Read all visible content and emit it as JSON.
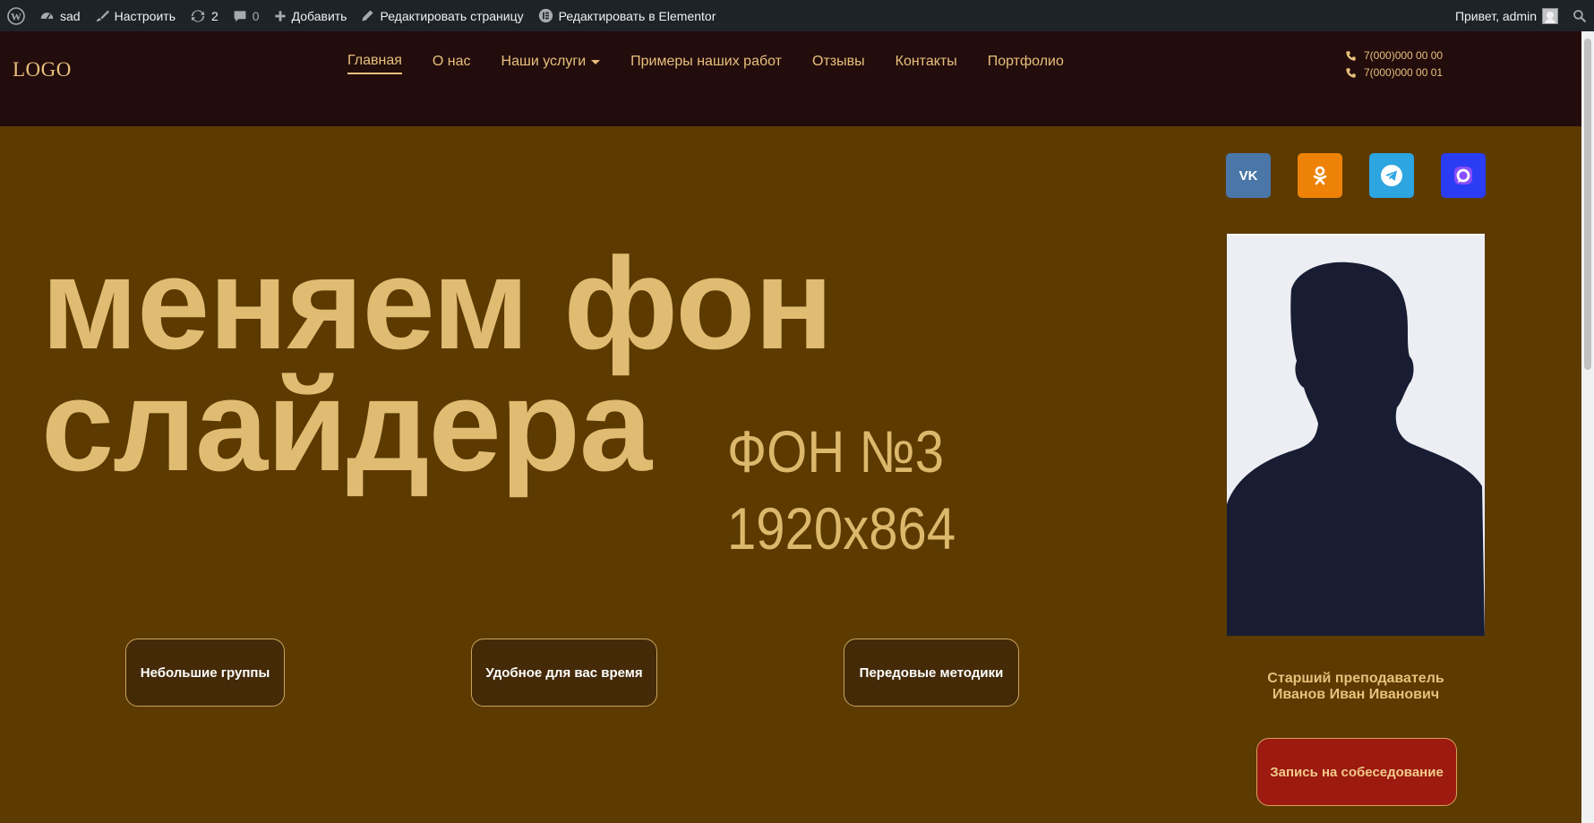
{
  "adminbar": {
    "site_name": "sad",
    "customize": "Настроить",
    "updates_count": "2",
    "comments_count": "0",
    "add_new": "Добавить",
    "edit_page": "Редактировать страницу",
    "edit_elementor": "Редактировать в Elementor",
    "greeting": "Привет, admin"
  },
  "header": {
    "logo": "LOGO",
    "nav": [
      "Главная",
      "О нас",
      "Наши услуги",
      "Примеры наших работ",
      "Отзывы",
      "Контакты",
      "Портфолио"
    ],
    "phones": [
      "7(000)000 00 00",
      "7(000)000 00 01"
    ]
  },
  "hero": {
    "title_line1": "меняем фон",
    "title_line2": "слайдера",
    "bg_label_line1": "ФОН №3",
    "bg_label_line2": "1920x864",
    "features": [
      "Небольшие группы",
      "Удобное для вас время",
      "Передовые методики"
    ],
    "teacher_role": "Старший преподаватель",
    "teacher_name": "Иванов Иван Иванович",
    "cta_label": "Запись на собеседование"
  },
  "colors": {
    "accent": "#e7c07c",
    "header_bg": "#230c0c",
    "hero_bg": "#5c3a00",
    "cta_bg": "#9c1a10",
    "vk": "#4a76a8",
    "ok": "#ee8208",
    "telegram": "#2ca5e0",
    "max": "#2a3cf4"
  },
  "socials": [
    "vk-icon",
    "odnoklassniki-icon",
    "telegram-icon",
    "max-messenger-icon"
  ]
}
